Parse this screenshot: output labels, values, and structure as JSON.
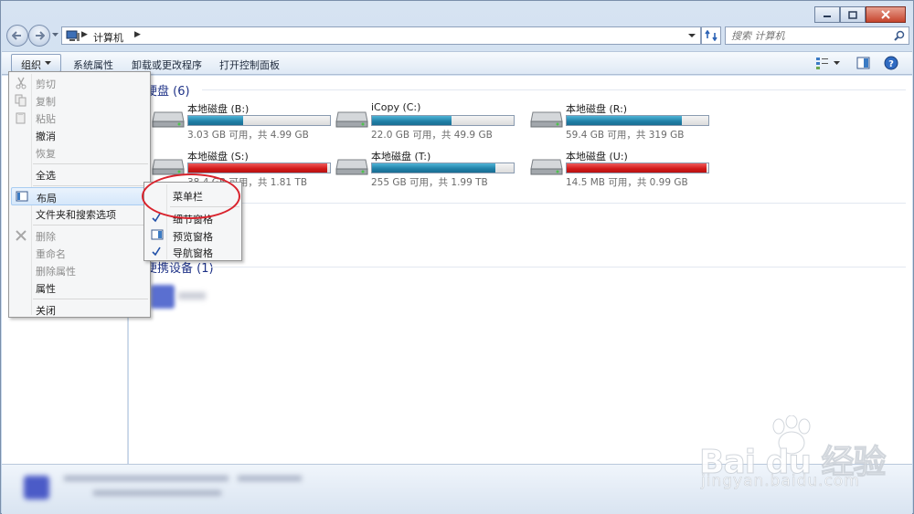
{
  "window": {
    "controls": [
      "minimize",
      "maximize",
      "close"
    ]
  },
  "address": {
    "crumb": "计算机"
  },
  "search": {
    "placeholder": "搜索 计算机"
  },
  "toolbar": {
    "organize": "组织",
    "system_properties": "系统属性",
    "uninstall": "卸载或更改程序",
    "control_panel": "打开控制面板"
  },
  "groups": {
    "hard_disks": "硬盘 (6)",
    "portable": "便携设备 (1)"
  },
  "drives": [
    {
      "name": "本地磁盘 (B:)",
      "space": "3.03 GB 可用，共 4.99 GB",
      "used_fraction": 0.39,
      "color": "blue"
    },
    {
      "name": "iCopy (C:)",
      "space": "22.0 GB 可用，共 49.9 GB",
      "used_fraction": 0.56,
      "color": "blue"
    },
    {
      "name": "本地磁盘 (R:)",
      "space": "59.4 GB 可用，共 319 GB",
      "used_fraction": 0.81,
      "color": "blue"
    },
    {
      "name": "本地磁盘 (S:)",
      "space": "38.4 GB 可用，共 1.81 TB",
      "used_fraction": 0.98,
      "color": "red"
    },
    {
      "name": "本地磁盘 (T:)",
      "space": "255 GB 可用，共 1.99 TB",
      "used_fraction": 0.87,
      "color": "blue"
    },
    {
      "name": "本地磁盘 (U:)",
      "space": "14.5 MB 可用，共 0.99 GB",
      "used_fraction": 0.99,
      "color": "red"
    }
  ],
  "menu": {
    "cut": "剪切",
    "copy": "复制",
    "paste": "粘贴",
    "undo": "撤消",
    "redo": "恢复",
    "select_all": "全选",
    "layout": "布局",
    "folder_options": "文件夹和搜索选项",
    "delete": "删除",
    "rename": "重命名",
    "remove_properties": "删除属性",
    "properties": "属性",
    "close": "关闭"
  },
  "submenu": {
    "menu_bar": "菜单栏",
    "details_pane": "细节窗格",
    "preview_pane": "预览窗格",
    "navigation_pane": "导航窗格"
  },
  "watermark": {
    "brand": "Bai du 经验",
    "url": "jingyan.baidu.com"
  },
  "colors": {
    "link_blue": "#1e3287",
    "bar_blue": "#26a0da",
    "bar_red": "#da2626",
    "annotation_red": "#d9232d"
  }
}
